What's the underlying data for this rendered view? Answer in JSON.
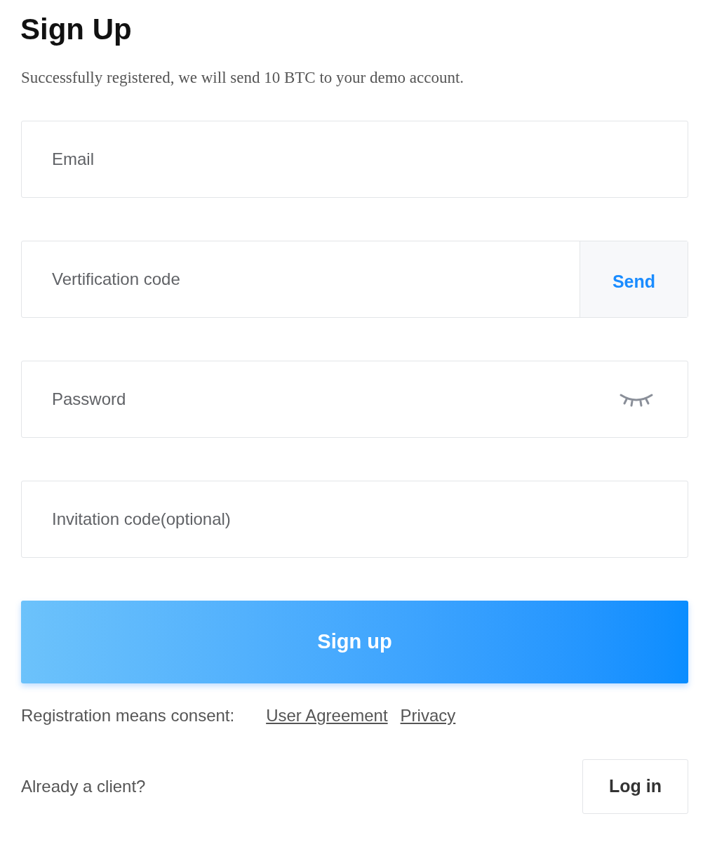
{
  "title": "Sign Up",
  "subtitle": "Successfully registered, we will send 10 BTC to your demo account.",
  "fields": [
    {
      "kind": "plain",
      "placeholder": "Email"
    },
    {
      "kind": "code",
      "placeholder": "Vertification code",
      "action": "Send"
    },
    {
      "kind": "password",
      "placeholder": "Password"
    },
    {
      "kind": "plain",
      "placeholder": "Invitation code(optional)"
    }
  ],
  "submit": "Sign up",
  "consent": {
    "label": "Registration means consent:",
    "links": [
      "User Agreement",
      "Privacy"
    ]
  },
  "login": {
    "prompt": "Already a client?",
    "button": "Log in"
  }
}
